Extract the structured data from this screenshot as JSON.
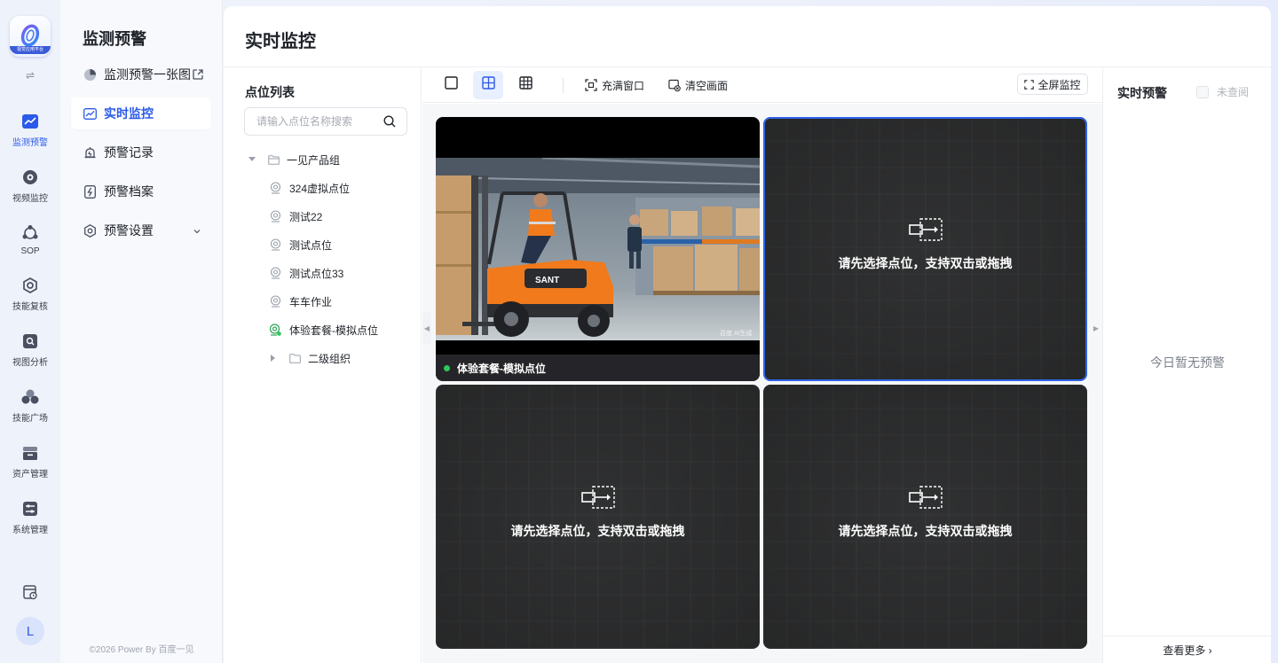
{
  "app": {
    "logo_text": "视觉应用平台",
    "brand_color": "#2b5ae8",
    "user_initial": "L",
    "copyright": "©2026 Power By 百度一见"
  },
  "rail": {
    "items": [
      {
        "label": "监测预警",
        "icon": "line-chart-icon",
        "active": true
      },
      {
        "label": "视频监控",
        "icon": "video-disc-icon",
        "active": false
      },
      {
        "label": "SOP",
        "icon": "sop-nodes-icon",
        "active": false
      },
      {
        "label": "技能复核",
        "icon": "hexagon-target-icon",
        "active": false
      },
      {
        "label": "视图分析",
        "icon": "image-search-icon",
        "active": false
      },
      {
        "label": "技能广场",
        "icon": "cluster-icon",
        "active": false
      },
      {
        "label": "资产管理",
        "icon": "asset-box-icon",
        "active": false
      },
      {
        "label": "系统管理",
        "icon": "settings-sliders-icon",
        "active": false
      }
    ]
  },
  "menu": {
    "title": "监测预警",
    "items": [
      {
        "label": "监测预警一张图",
        "icon": "pie-chart-icon",
        "trail": "external-link-icon",
        "active": false
      },
      {
        "label": "实时监控",
        "icon": "monitor-chart-icon",
        "active": true
      },
      {
        "label": "预警记录",
        "icon": "alarm-bell-icon",
        "active": false
      },
      {
        "label": "预警档案",
        "icon": "alert-file-icon",
        "active": false
      },
      {
        "label": "预警设置",
        "icon": "settings-gear-icon",
        "trail": "chevron-down-icon",
        "active": false
      }
    ]
  },
  "page": {
    "title": "实时监控"
  },
  "point_list": {
    "title": "点位列表",
    "search_placeholder": "请输入点位名称搜索",
    "group": "一见产品组",
    "items": [
      "324虚拟点位",
      "测试22",
      "测试点位",
      "测试点位33",
      "车车作业",
      "体验套餐-模拟点位"
    ],
    "active_item_index": 5,
    "subgroup": "二级组织"
  },
  "toolbar": {
    "layouts": [
      "single-view-icon",
      "quad-view-icon",
      "nine-view-icon"
    ],
    "active_layout": 1,
    "fill_window": "充满窗口",
    "clear_screen": "清空画面",
    "fullscreen": "全屏监控"
  },
  "tiles": [
    {
      "type": "video",
      "label": "体验套餐-模拟点位",
      "watermark": "百度 AI生成",
      "status_color": "#2ec75a"
    },
    {
      "type": "empty",
      "text": "请先选择点位，支持双击或拖拽",
      "selected": true
    },
    {
      "type": "empty",
      "text": "请先选择点位，支持双击或拖拽",
      "selected": false
    },
    {
      "type": "empty",
      "text": "请先选择点位，支持双击或拖拽",
      "selected": false
    }
  ],
  "alerts": {
    "title": "实时预警",
    "unread_label": "未查阅",
    "empty_text": "今日暂无预警",
    "more_label": "查看更多 ›"
  }
}
